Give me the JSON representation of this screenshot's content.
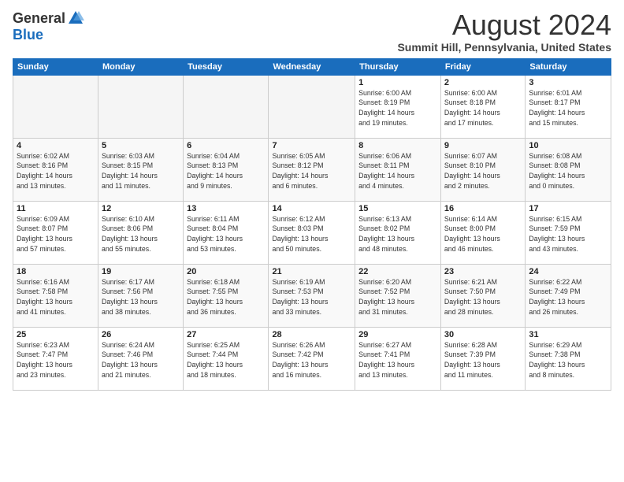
{
  "logo": {
    "general": "General",
    "blue": "Blue"
  },
  "title": "August 2024",
  "subtitle": "Summit Hill, Pennsylvania, United States",
  "days_of_week": [
    "Sunday",
    "Monday",
    "Tuesday",
    "Wednesday",
    "Thursday",
    "Friday",
    "Saturday"
  ],
  "weeks": [
    [
      {
        "day": "",
        "info": ""
      },
      {
        "day": "",
        "info": ""
      },
      {
        "day": "",
        "info": ""
      },
      {
        "day": "",
        "info": ""
      },
      {
        "day": "1",
        "info": "Sunrise: 6:00 AM\nSunset: 8:19 PM\nDaylight: 14 hours\nand 19 minutes."
      },
      {
        "day": "2",
        "info": "Sunrise: 6:00 AM\nSunset: 8:18 PM\nDaylight: 14 hours\nand 17 minutes."
      },
      {
        "day": "3",
        "info": "Sunrise: 6:01 AM\nSunset: 8:17 PM\nDaylight: 14 hours\nand 15 minutes."
      }
    ],
    [
      {
        "day": "4",
        "info": "Sunrise: 6:02 AM\nSunset: 8:16 PM\nDaylight: 14 hours\nand 13 minutes."
      },
      {
        "day": "5",
        "info": "Sunrise: 6:03 AM\nSunset: 8:15 PM\nDaylight: 14 hours\nand 11 minutes."
      },
      {
        "day": "6",
        "info": "Sunrise: 6:04 AM\nSunset: 8:13 PM\nDaylight: 14 hours\nand 9 minutes."
      },
      {
        "day": "7",
        "info": "Sunrise: 6:05 AM\nSunset: 8:12 PM\nDaylight: 14 hours\nand 6 minutes."
      },
      {
        "day": "8",
        "info": "Sunrise: 6:06 AM\nSunset: 8:11 PM\nDaylight: 14 hours\nand 4 minutes."
      },
      {
        "day": "9",
        "info": "Sunrise: 6:07 AM\nSunset: 8:10 PM\nDaylight: 14 hours\nand 2 minutes."
      },
      {
        "day": "10",
        "info": "Sunrise: 6:08 AM\nSunset: 8:08 PM\nDaylight: 14 hours\nand 0 minutes."
      }
    ],
    [
      {
        "day": "11",
        "info": "Sunrise: 6:09 AM\nSunset: 8:07 PM\nDaylight: 13 hours\nand 57 minutes."
      },
      {
        "day": "12",
        "info": "Sunrise: 6:10 AM\nSunset: 8:06 PM\nDaylight: 13 hours\nand 55 minutes."
      },
      {
        "day": "13",
        "info": "Sunrise: 6:11 AM\nSunset: 8:04 PM\nDaylight: 13 hours\nand 53 minutes."
      },
      {
        "day": "14",
        "info": "Sunrise: 6:12 AM\nSunset: 8:03 PM\nDaylight: 13 hours\nand 50 minutes."
      },
      {
        "day": "15",
        "info": "Sunrise: 6:13 AM\nSunset: 8:02 PM\nDaylight: 13 hours\nand 48 minutes."
      },
      {
        "day": "16",
        "info": "Sunrise: 6:14 AM\nSunset: 8:00 PM\nDaylight: 13 hours\nand 46 minutes."
      },
      {
        "day": "17",
        "info": "Sunrise: 6:15 AM\nSunset: 7:59 PM\nDaylight: 13 hours\nand 43 minutes."
      }
    ],
    [
      {
        "day": "18",
        "info": "Sunrise: 6:16 AM\nSunset: 7:58 PM\nDaylight: 13 hours\nand 41 minutes."
      },
      {
        "day": "19",
        "info": "Sunrise: 6:17 AM\nSunset: 7:56 PM\nDaylight: 13 hours\nand 38 minutes."
      },
      {
        "day": "20",
        "info": "Sunrise: 6:18 AM\nSunset: 7:55 PM\nDaylight: 13 hours\nand 36 minutes."
      },
      {
        "day": "21",
        "info": "Sunrise: 6:19 AM\nSunset: 7:53 PM\nDaylight: 13 hours\nand 33 minutes."
      },
      {
        "day": "22",
        "info": "Sunrise: 6:20 AM\nSunset: 7:52 PM\nDaylight: 13 hours\nand 31 minutes."
      },
      {
        "day": "23",
        "info": "Sunrise: 6:21 AM\nSunset: 7:50 PM\nDaylight: 13 hours\nand 28 minutes."
      },
      {
        "day": "24",
        "info": "Sunrise: 6:22 AM\nSunset: 7:49 PM\nDaylight: 13 hours\nand 26 minutes."
      }
    ],
    [
      {
        "day": "25",
        "info": "Sunrise: 6:23 AM\nSunset: 7:47 PM\nDaylight: 13 hours\nand 23 minutes."
      },
      {
        "day": "26",
        "info": "Sunrise: 6:24 AM\nSunset: 7:46 PM\nDaylight: 13 hours\nand 21 minutes."
      },
      {
        "day": "27",
        "info": "Sunrise: 6:25 AM\nSunset: 7:44 PM\nDaylight: 13 hours\nand 18 minutes."
      },
      {
        "day": "28",
        "info": "Sunrise: 6:26 AM\nSunset: 7:42 PM\nDaylight: 13 hours\nand 16 minutes."
      },
      {
        "day": "29",
        "info": "Sunrise: 6:27 AM\nSunset: 7:41 PM\nDaylight: 13 hours\nand 13 minutes."
      },
      {
        "day": "30",
        "info": "Sunrise: 6:28 AM\nSunset: 7:39 PM\nDaylight: 13 hours\nand 11 minutes."
      },
      {
        "day": "31",
        "info": "Sunrise: 6:29 AM\nSunset: 7:38 PM\nDaylight: 13 hours\nand 8 minutes."
      }
    ]
  ]
}
